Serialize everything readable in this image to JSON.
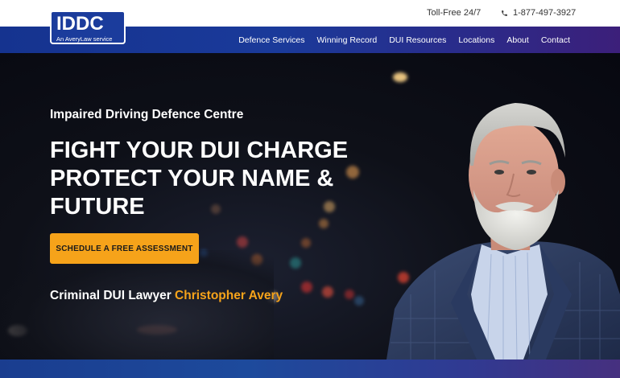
{
  "logo": {
    "main": "IDDC",
    "sub": "An AveryLaw service"
  },
  "topbar": {
    "tollfree": "Toll-Free 24/7",
    "phone": "1-877-497-3927"
  },
  "nav": {
    "items": [
      {
        "label": "Defence Services"
      },
      {
        "label": "Winning Record"
      },
      {
        "label": "DUI Resources"
      },
      {
        "label": "Locations"
      },
      {
        "label": "About"
      },
      {
        "label": "Contact"
      }
    ]
  },
  "hero": {
    "subtitle": "Impaired Driving Defence Centre",
    "title_line1": "FIGHT YOUR DUI CHARGE",
    "title_line2": "PROTECT YOUR NAME &",
    "title_line3": "FUTURE",
    "cta_label": "SCHEDULE A FREE ASSESSMENT",
    "lawyer_prefix": "Criminal DUI Lawyer ",
    "lawyer_name": "Christopher Avery"
  },
  "colors": {
    "accent": "#f6a31a",
    "nav_blue": "#1a3a9a",
    "nav_purple": "#3c1f7a",
    "hero_bg": "#0b0d14"
  },
  "icons": {
    "phone": "phone-icon"
  }
}
